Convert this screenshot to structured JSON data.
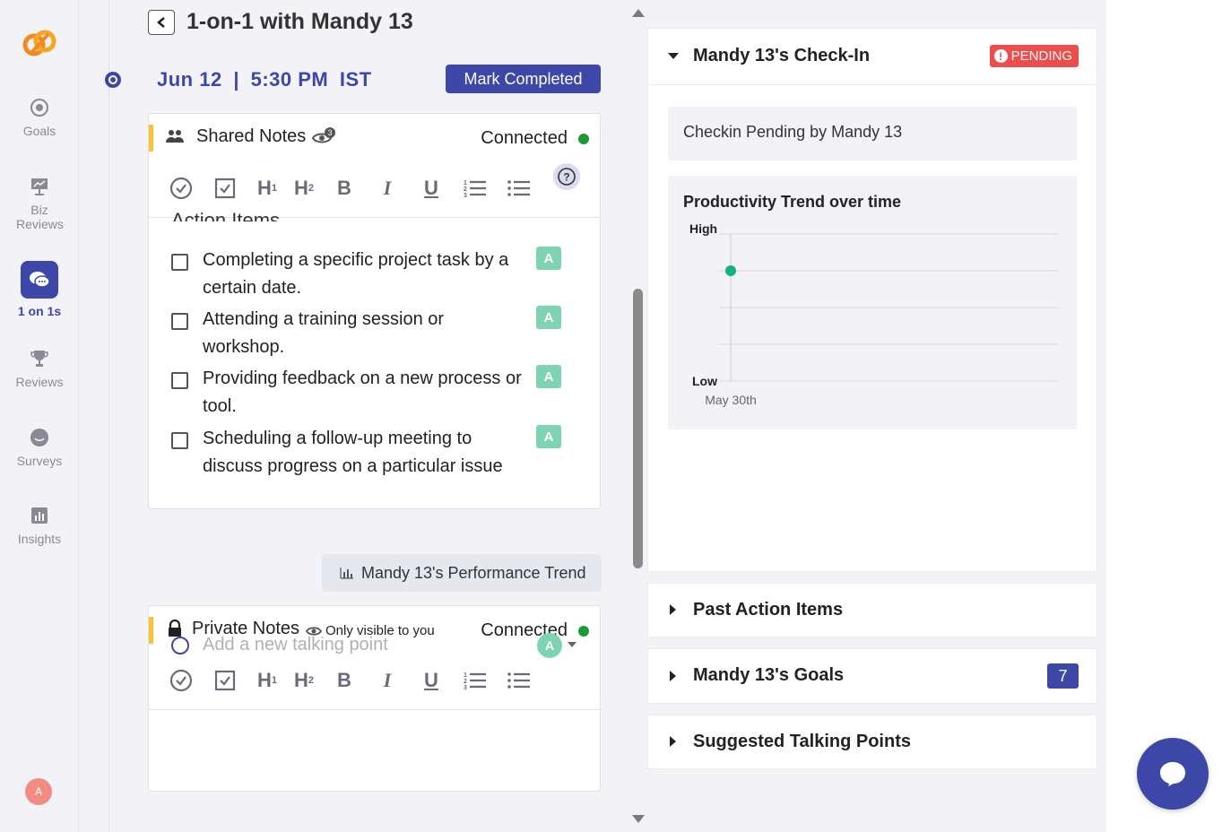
{
  "sidebar": {
    "items": [
      {
        "label": "Goals",
        "icon": "target-icon"
      },
      {
        "label": "Biz Reviews",
        "icon": "presentation-icon"
      },
      {
        "label": "1 on 1s",
        "icon": "chat-bubbles-icon",
        "active": true
      },
      {
        "label": "Reviews",
        "icon": "trophy-icon"
      },
      {
        "label": "Surveys",
        "icon": "survey-bubble-icon"
      },
      {
        "label": "Insights",
        "icon": "bar-chart-icon"
      }
    ],
    "user_initial": "A"
  },
  "header": {
    "title": "1-on-1 with Mandy 13",
    "date": "Jun 12",
    "separator": "|",
    "time": "5:30 PM",
    "timezone": "IST",
    "mark_completed_label": "Mark Completed"
  },
  "shared_notes": {
    "title": "Shared Notes",
    "viewers_count": "3",
    "status": "Connected",
    "section_heading": "Action Items",
    "items": [
      {
        "text": "Completing a specific project task by a certain date.",
        "assignee": "A"
      },
      {
        "text": "Attending a training session or workshop.",
        "assignee": "A"
      },
      {
        "text": "Providing feedback on a new process or tool.",
        "assignee": "A"
      },
      {
        "text": "Scheduling a follow-up meeting to discuss progress on a particular issue",
        "assignee": "A"
      }
    ]
  },
  "performance_trend_label": "Mandy 13's Performance Trend",
  "private_notes": {
    "title": "Private Notes",
    "visibility": "Only visible to you",
    "status": "Connected",
    "placeholder": "Add a new talking point",
    "assignee": "A"
  },
  "toolbar": {
    "h1": "H",
    "h1_sub": "1",
    "h2": "H",
    "h2_sub": "2",
    "bold": "B",
    "italic": "I",
    "underline": "U",
    "help": "?"
  },
  "checkin": {
    "title": "Mandy 13's Check-In",
    "status_badge": "PENDING",
    "status_icon_glyph": "!",
    "pending_text": "Checkin Pending by Mandy 13",
    "chart_title": "Productivity Trend over time"
  },
  "chart_data": {
    "type": "scatter",
    "title": "Productivity Trend over time",
    "y_categories": [
      "Low",
      "",
      "",
      "",
      "High"
    ],
    "y_labels_shown": {
      "top": "High",
      "bottom": "Low"
    },
    "x": [
      "May 30th"
    ],
    "series": [
      {
        "values": [
          3
        ]
      }
    ],
    "ylim": [
      0,
      4
    ],
    "grid": true,
    "point_color": "#19b07f"
  },
  "sections": [
    {
      "title": "Past Action Items"
    },
    {
      "title": "Mandy 13's Goals",
      "count": "7"
    },
    {
      "title": "Suggested Talking Points"
    }
  ],
  "colors": {
    "accent": "#3d47a8",
    "pending": "#ee4d4d",
    "connected": "#1a9a34",
    "assignee": "#7ed3b2",
    "highlight_bar": "#f6c433"
  }
}
